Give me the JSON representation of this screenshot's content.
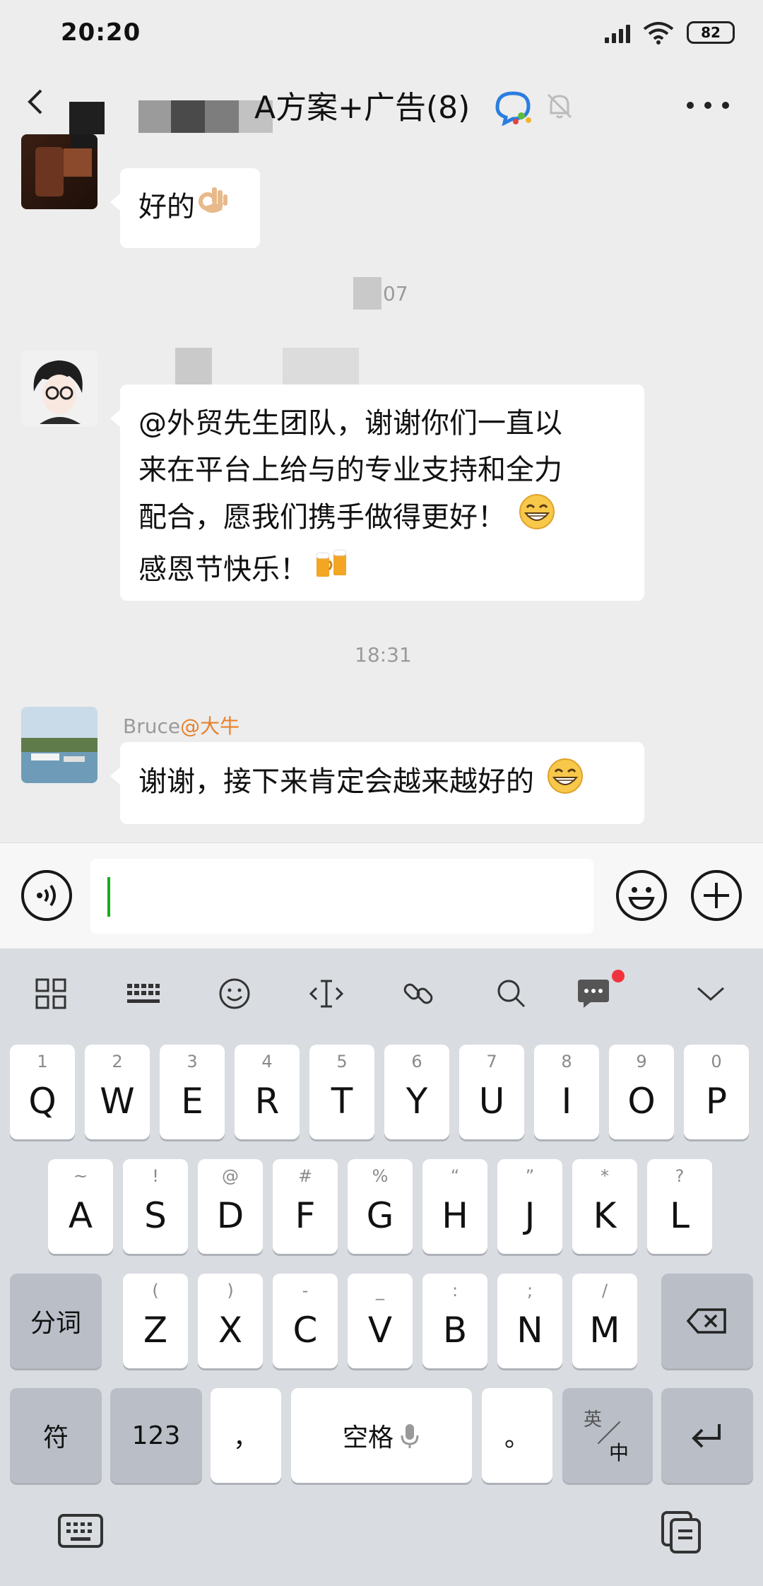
{
  "status_bar": {
    "time": "20:20",
    "battery": "82"
  },
  "nav": {
    "title_visible": "A方案+广告(8)"
  },
  "messages": [
    {
      "text": "好的"
    },
    {
      "time_fragment": "07"
    },
    {
      "lines": [
        "@外贸先生团队，谢谢你们一直以",
        "来在平台上给与的专业支持和全力",
        "配合，愿我们携手做得更好！",
        "感恩节快乐！"
      ]
    },
    {
      "timestamp": "18:31"
    },
    {
      "sender": "Bruce",
      "sender_tag": "@大牛",
      "text": "谢谢，接下来肯定会越来越好的"
    }
  ],
  "input": {
    "value": ""
  },
  "keyboard": {
    "row1": [
      {
        "key": "Q",
        "sub": "1"
      },
      {
        "key": "W",
        "sub": "2"
      },
      {
        "key": "E",
        "sub": "3"
      },
      {
        "key": "R",
        "sub": "4"
      },
      {
        "key": "T",
        "sub": "5"
      },
      {
        "key": "Y",
        "sub": "6"
      },
      {
        "key": "U",
        "sub": "7"
      },
      {
        "key": "I",
        "sub": "8"
      },
      {
        "key": "O",
        "sub": "9"
      },
      {
        "key": "P",
        "sub": "0"
      }
    ],
    "row2": [
      {
        "key": "A",
        "sub": "~"
      },
      {
        "key": "S",
        "sub": "!"
      },
      {
        "key": "D",
        "sub": "@"
      },
      {
        "key": "F",
        "sub": "#"
      },
      {
        "key": "G",
        "sub": "%"
      },
      {
        "key": "H",
        "sub": "“"
      },
      {
        "key": "J",
        "sub": "”"
      },
      {
        "key": "K",
        "sub": "*"
      },
      {
        "key": "L",
        "sub": "?"
      }
    ],
    "row3": [
      {
        "key": "Z",
        "sub": "("
      },
      {
        "key": "X",
        "sub": ")"
      },
      {
        "key": "C",
        "sub": "-"
      },
      {
        "key": "V",
        "sub": "_"
      },
      {
        "key": "B",
        "sub": ":"
      },
      {
        "key": "N",
        "sub": ";"
      },
      {
        "key": "M",
        "sub": "/"
      }
    ],
    "fenci": "分词",
    "fu": "符",
    "num": "123",
    "comma": "，",
    "space": "空格",
    "period": "。",
    "lang_top": "英",
    "lang_bottom": "中"
  },
  "colors": {
    "accent_green": "#1aad19",
    "name_highlight": "#e6812b",
    "badge_red": "#f0333c"
  }
}
